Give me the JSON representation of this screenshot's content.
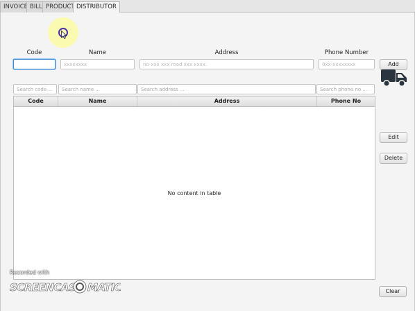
{
  "tabs": [
    {
      "label": "INVOICE",
      "active": false
    },
    {
      "label": "BILL",
      "active": false
    },
    {
      "label": "PRODUCT",
      "active": false
    },
    {
      "label": "DISTRIBUTOR",
      "active": true
    }
  ],
  "form": {
    "code_label": "Code",
    "name_label": "Name",
    "address_label": "Address",
    "phone_label": "Phone Number",
    "code_value": "",
    "name_placeholder": "xxxxxxxx",
    "address_placeholder": "no-xxx xxx road xxx xxxx.",
    "phone_placeholder": "0xx-xxxxxxxx",
    "add_label": "Add"
  },
  "search": {
    "code_placeholder": "Search code ...",
    "name_placeholder": "Search name ...",
    "address_placeholder": "Search address ...",
    "phone_placeholder": "Search phone no ..."
  },
  "table": {
    "columns": [
      "Code",
      "Name",
      "Address",
      "Phone No"
    ],
    "rows": [],
    "empty_message": "No content in table"
  },
  "actions": {
    "edit_label": "Edit",
    "delete_label": "Delete",
    "clear_label": "Clear"
  },
  "icons": {
    "truck": "truck-icon",
    "cursor": "mouse-pointer-icon"
  },
  "watermark": {
    "recorded_with": "Recorded with",
    "brand": "SCREENCAST-O-MATIC"
  },
  "colors": {
    "focus": "#3b8bd6",
    "truck": "#2b3540",
    "highlight": "#ffff78"
  }
}
